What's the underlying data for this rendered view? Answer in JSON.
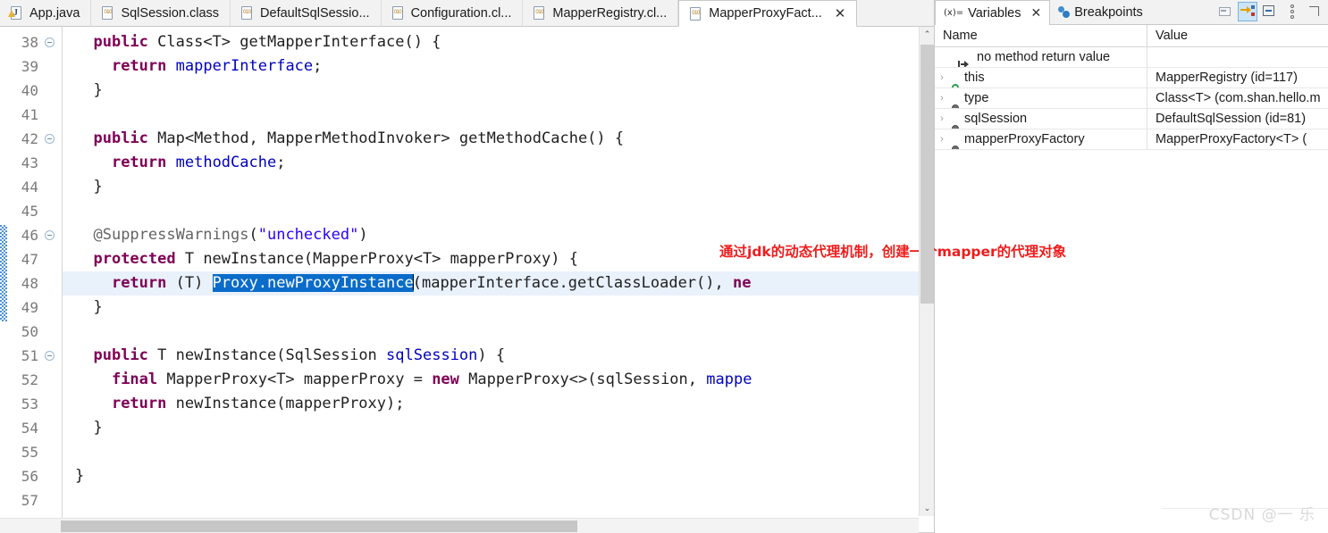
{
  "editor": {
    "tabs": [
      {
        "label": "App.java",
        "icon": "java-file-icon",
        "active": false,
        "closable": false
      },
      {
        "label": "SqlSession.class",
        "icon": "class-file-icon",
        "active": false,
        "closable": false
      },
      {
        "label": "DefaultSqlSessio...",
        "icon": "class-file-icon",
        "active": false,
        "closable": false
      },
      {
        "label": "Configuration.cl...",
        "icon": "class-file-icon",
        "active": false,
        "closable": false
      },
      {
        "label": "MapperRegistry.cl...",
        "icon": "class-file-icon",
        "active": false,
        "closable": false
      },
      {
        "label": "MapperProxyFact...",
        "icon": "class-file-icon",
        "active": true,
        "closable": true
      }
    ],
    "close_glyph": "✕",
    "annotation": "通过jdk的动态代理机制，创建一个mapper的代理对象",
    "lines": [
      {
        "num": "38",
        "fold": true,
        "current": false,
        "tokens": [
          {
            "t": "  ",
            "c": ""
          },
          {
            "t": "public",
            "c": "kw"
          },
          {
            "t": " Class<T> getMapperInterface() {",
            "c": ""
          }
        ]
      },
      {
        "num": "39",
        "fold": false,
        "current": false,
        "tokens": [
          {
            "t": "    ",
            "c": ""
          },
          {
            "t": "return",
            "c": "kw"
          },
          {
            "t": " ",
            "c": ""
          },
          {
            "t": "mapperInterface",
            "c": "fld"
          },
          {
            "t": ";",
            "c": ""
          }
        ]
      },
      {
        "num": "40",
        "fold": false,
        "current": false,
        "tokens": [
          {
            "t": "  }",
            "c": ""
          }
        ]
      },
      {
        "num": "41",
        "fold": false,
        "current": false,
        "tokens": [
          {
            "t": "",
            "c": ""
          }
        ]
      },
      {
        "num": "42",
        "fold": true,
        "current": false,
        "tokens": [
          {
            "t": "  ",
            "c": ""
          },
          {
            "t": "public",
            "c": "kw"
          },
          {
            "t": " Map<Method, MapperMethodInvoker> getMethodCache() {",
            "c": ""
          }
        ]
      },
      {
        "num": "43",
        "fold": false,
        "current": false,
        "tokens": [
          {
            "t": "    ",
            "c": ""
          },
          {
            "t": "return",
            "c": "kw"
          },
          {
            "t": " ",
            "c": ""
          },
          {
            "t": "methodCache",
            "c": "fld"
          },
          {
            "t": ";",
            "c": ""
          }
        ]
      },
      {
        "num": "44",
        "fold": false,
        "current": false,
        "tokens": [
          {
            "t": "  }",
            "c": ""
          }
        ]
      },
      {
        "num": "45",
        "fold": false,
        "current": false,
        "tokens": [
          {
            "t": "",
            "c": ""
          }
        ]
      },
      {
        "num": "46",
        "fold": true,
        "current": false,
        "tokens": [
          {
            "t": "  ",
            "c": ""
          },
          {
            "t": "@SuppressWarnings",
            "c": "ann"
          },
          {
            "t": "(",
            "c": ""
          },
          {
            "t": "\"unchecked\"",
            "c": "str"
          },
          {
            "t": ")",
            "c": ""
          }
        ]
      },
      {
        "num": "47",
        "fold": false,
        "current": false,
        "tokens": [
          {
            "t": "  ",
            "c": ""
          },
          {
            "t": "protected",
            "c": "kw"
          },
          {
            "t": " T newInstance(MapperProxy<T> mapperProxy) {",
            "c": ""
          }
        ]
      },
      {
        "num": "48",
        "fold": false,
        "current": true,
        "tokens": [
          {
            "t": "    ",
            "c": ""
          },
          {
            "t": "return",
            "c": "kw"
          },
          {
            "t": " (T) ",
            "c": ""
          },
          {
            "t": "Proxy.",
            "c": "sel"
          },
          {
            "t": "newProxyInstance",
            "c": "sel-it"
          },
          {
            "t": "|",
            "c": "caret"
          },
          {
            "t": "(mapperInterface",
            "c": ""
          },
          {
            "t": ".getClassLoader(), ",
            "c": ""
          },
          {
            "t": "ne",
            "c": "kw"
          }
        ]
      },
      {
        "num": "49",
        "fold": false,
        "current": false,
        "tokens": [
          {
            "t": "  }",
            "c": ""
          }
        ]
      },
      {
        "num": "50",
        "fold": false,
        "current": false,
        "tokens": [
          {
            "t": "",
            "c": ""
          }
        ]
      },
      {
        "num": "51",
        "fold": true,
        "current": false,
        "tokens": [
          {
            "t": "  ",
            "c": ""
          },
          {
            "t": "public",
            "c": "kw"
          },
          {
            "t": " T newInstance(",
            "c": ""
          },
          {
            "t": "SqlSession",
            "c": ""
          },
          {
            "t": " ",
            "c": ""
          },
          {
            "t": "sqlSession",
            "c": "fld"
          },
          {
            "t": ") {",
            "c": ""
          }
        ]
      },
      {
        "num": "52",
        "fold": false,
        "current": false,
        "tokens": [
          {
            "t": "    ",
            "c": ""
          },
          {
            "t": "final",
            "c": "kw"
          },
          {
            "t": " MapperProxy<T> mapperProxy = ",
            "c": ""
          },
          {
            "t": "new",
            "c": "kw"
          },
          {
            "t": " MapperProxy<>(sqlSession, ",
            "c": ""
          },
          {
            "t": "mappe",
            "c": "fld"
          }
        ]
      },
      {
        "num": "53",
        "fold": false,
        "current": false,
        "tokens": [
          {
            "t": "    ",
            "c": ""
          },
          {
            "t": "return",
            "c": "kw"
          },
          {
            "t": " newInstance(mapperProxy);",
            "c": ""
          }
        ]
      },
      {
        "num": "54",
        "fold": false,
        "current": false,
        "tokens": [
          {
            "t": "  }",
            "c": ""
          }
        ]
      },
      {
        "num": "55",
        "fold": false,
        "current": false,
        "tokens": [
          {
            "t": "",
            "c": ""
          }
        ]
      },
      {
        "num": "56",
        "fold": false,
        "current": false,
        "tokens": [
          {
            "t": "}",
            "c": ""
          }
        ]
      },
      {
        "num": "57",
        "fold": false,
        "current": false,
        "tokens": [
          {
            "t": "",
            "c": ""
          }
        ]
      }
    ],
    "scroll": {
      "up_arrow": "⌃",
      "down_arrow": "⌄"
    }
  },
  "variables_panel": {
    "tabs": [
      {
        "label": "Variables",
        "icon": "variables-icon",
        "active": true,
        "closable": true
      },
      {
        "label": "Breakpoints",
        "icon": "breakpoints-icon",
        "active": false,
        "closable": false
      }
    ],
    "close_glyph": "✕",
    "toolbar": [
      {
        "name": "snapshot-button",
        "selected": false
      },
      {
        "name": "show-logical-structure-button",
        "selected": true
      },
      {
        "name": "collapse-all-button",
        "selected": false
      },
      {
        "name": "view-menu-button",
        "selected": false
      },
      {
        "name": "pin-button",
        "selected": false
      }
    ],
    "columns": {
      "name": "Name",
      "value": "Value"
    },
    "rows": [
      {
        "name": "no method return value",
        "value": "",
        "icon": "return-value-icon",
        "twisty": "",
        "indent": true
      },
      {
        "name": "this",
        "value": "MapperRegistry  (id=117)",
        "icon": "green-dot-icon",
        "twisty": "›",
        "indent": false
      },
      {
        "name": "type",
        "value": "Class<T> (com.shan.hello.m",
        "icon": "gray-dot-icon",
        "twisty": "›",
        "indent": false
      },
      {
        "name": "sqlSession",
        "value": "DefaultSqlSession  (id=81)",
        "icon": "gray-dot-icon",
        "twisty": "›",
        "indent": false
      },
      {
        "name": "mapperProxyFactory",
        "value": "MapperProxyFactory<T>  (",
        "icon": "gray-dot-icon",
        "twisty": "›",
        "indent": false
      }
    ]
  },
  "watermark": {
    "text": "CSDN @一 乐"
  },
  "colors": {
    "keyword": "#7f0055",
    "field": "#0000c0",
    "string": "#2a00ff",
    "annotation_note": "#f01c1c",
    "selection": "#0a6cca",
    "current_line": "#e9f1fb",
    "change_bar": "#4a90d9"
  }
}
